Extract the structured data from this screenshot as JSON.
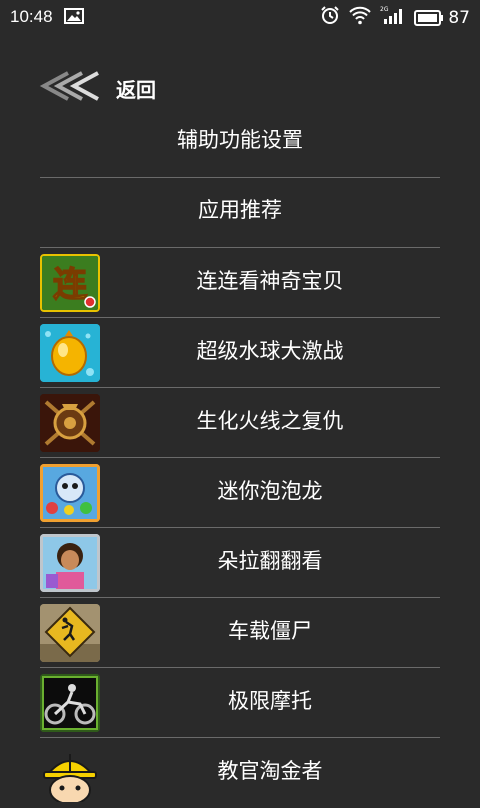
{
  "status_bar": {
    "time": "10:48",
    "battery": "87"
  },
  "nav": {
    "back_label": "返回"
  },
  "settings_title": "辅助功能设置",
  "section_title": "应用推荐",
  "apps": [
    {
      "name": "连连看神奇宝贝",
      "icon": "pokemon-link-icon"
    },
    {
      "name": "超级水球大激战",
      "icon": "water-balloon-icon"
    },
    {
      "name": "生化火线之复仇",
      "icon": "biohazard-emblem-icon"
    },
    {
      "name": "迷你泡泡龙",
      "icon": "bubble-dragon-icon"
    },
    {
      "name": "朵拉翻翻看",
      "icon": "dora-icon"
    },
    {
      "name": "车载僵尸",
      "icon": "zombie-road-sign-icon"
    },
    {
      "name": "极限摩托",
      "icon": "motorbike-icon"
    },
    {
      "name": "教官淘金者",
      "icon": "gold-miner-icon"
    }
  ]
}
